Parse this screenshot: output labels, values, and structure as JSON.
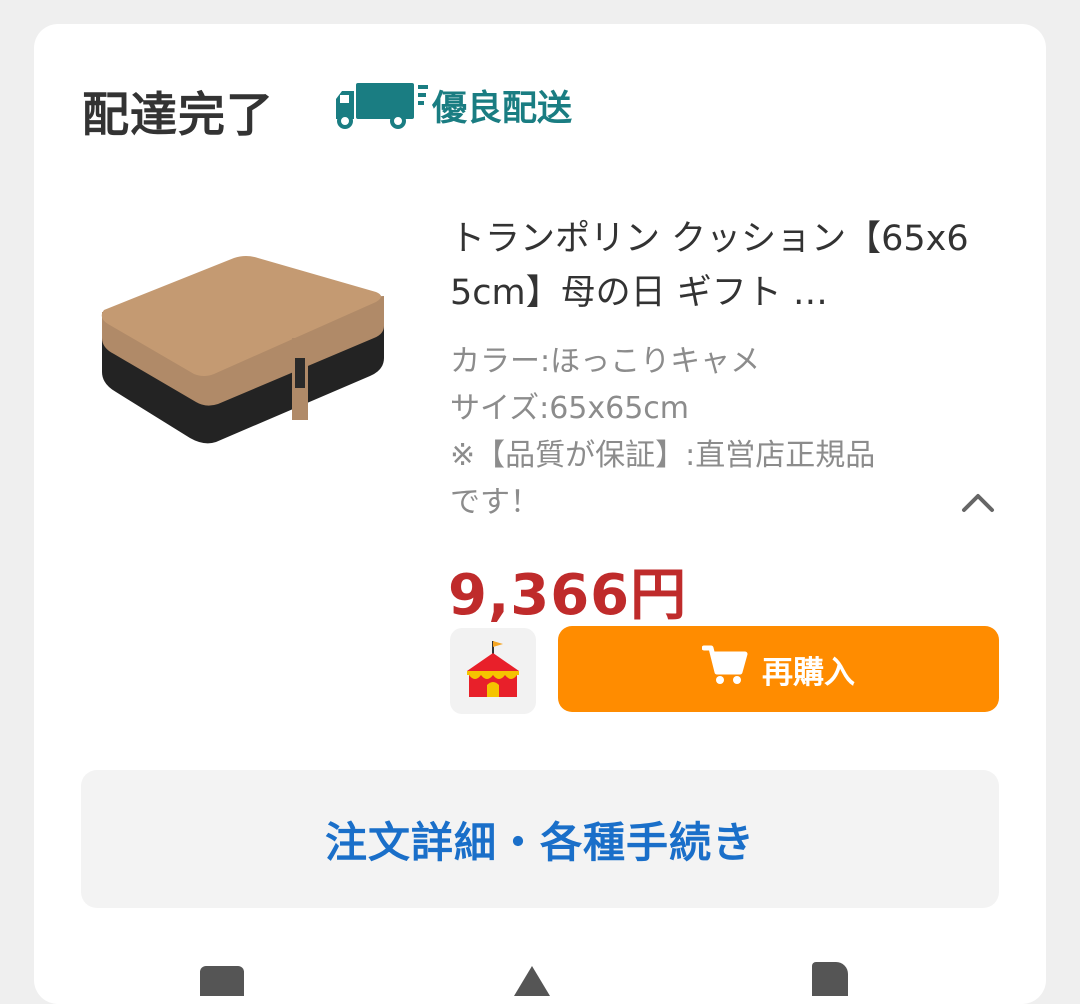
{
  "order": {
    "status": "配達完了",
    "shipping_badge": "優良配送"
  },
  "product": {
    "title": "トランポリン クッション【65x65cm】母の日 ギフト …",
    "options": [
      "カラー:ほっこりキャメ",
      "サイズ:65x65cm",
      "※【品質が保証】:直営店正規品",
      "です！"
    ],
    "price": "9,366円"
  },
  "actions": {
    "rebuy_label": "再購入",
    "details_label": "注文詳細・各種手続き"
  },
  "icons": {
    "shipping": "delivery-truck-icon",
    "collapse": "chevron-up-icon",
    "store": "circus-tent-icon",
    "cart": "shopping-cart-icon"
  },
  "colors": {
    "shipping_badge": "#1a7d82",
    "price": "#bf2b2b",
    "rebuy_button": "#ff8c00",
    "details_link": "#1a6fc9"
  }
}
